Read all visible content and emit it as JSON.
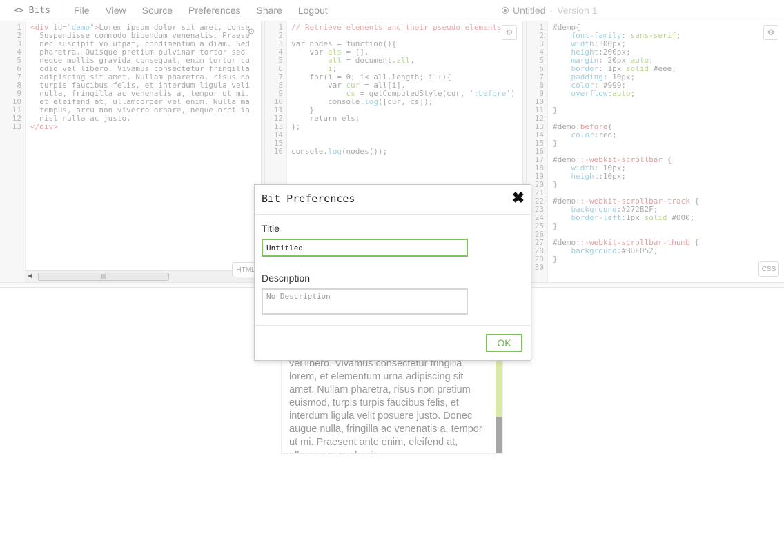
{
  "app": {
    "name": "Bits",
    "logo_icon": "<>"
  },
  "menu": [
    {
      "label": "File"
    },
    {
      "label": "View"
    },
    {
      "label": "Source"
    },
    {
      "label": "Preferences"
    },
    {
      "label": "Share"
    },
    {
      "label": "Logout"
    }
  ],
  "bit": {
    "title": "Untitled",
    "separator": "·",
    "version": "Version 1"
  },
  "editors": {
    "html": {
      "mode": "HTML",
      "lines": [
        "1",
        "2",
        "3",
        "4",
        "5",
        "6",
        "7",
        "8",
        "9",
        "10",
        "11",
        "12",
        "13"
      ],
      "code": [
        [
          {
            "c": "tok-tag",
            "t": "<div "
          },
          {
            "c": "tok-attr",
            "t": "id="
          },
          {
            "c": "tok-str",
            "t": "\"demo\""
          },
          {
            "c": "tok-tag",
            "t": ">"
          },
          {
            "c": "",
            "t": "Lorem ipsum dolor sit amet, conse"
          }
        ],
        [
          {
            "c": "",
            "t": "  Suspendisse commodo bibendum venenatis. Praese"
          }
        ],
        [
          {
            "c": "",
            "t": "  nec suscipit volutpat, condimentum a diam. Sed"
          }
        ],
        [
          {
            "c": "",
            "t": "  pharetra. Quisque pretium pulvinar tortor sed"
          }
        ],
        [
          {
            "c": "",
            "t": "  neque mollis gravida consequat, enim tortor cu"
          }
        ],
        [
          {
            "c": "",
            "t": "  odio vel libero. Vivamus consectetur fringilla"
          }
        ],
        [
          {
            "c": "",
            "t": "  adipiscing sit amet. Nullam pharetra, risus no"
          }
        ],
        [
          {
            "c": "",
            "t": "  turpis faucibus felis, et interdum ligula veli"
          }
        ],
        [
          {
            "c": "",
            "t": "  nulla, fringilla ac venenatis a, tempor ut mi."
          }
        ],
        [
          {
            "c": "",
            "t": "  et eleifend at, ullamcorper vel enim. Nulla ma"
          }
        ],
        [
          {
            "c": "",
            "t": "  tempus, arcu non viverra ornare, neque orci ia"
          }
        ],
        [
          {
            "c": "",
            "t": "  nisl nulla ac justo."
          }
        ],
        [
          {
            "c": "tok-tag",
            "t": "</div>"
          }
        ]
      ]
    },
    "js": {
      "lines": [
        "1",
        "2",
        "3",
        "4",
        "5",
        "6",
        "7",
        "8",
        "9",
        "10",
        "11",
        "12",
        "13",
        "14",
        "15",
        "16"
      ],
      "code": [
        [
          {
            "c": "tok-com",
            "t": "// Retrieve elements and their pseudo elements"
          }
        ],
        [
          {
            "c": "",
            "t": ""
          }
        ],
        [
          {
            "c": "",
            "t": "var nodes = function(){"
          }
        ],
        [
          {
            "c": "",
            "t": "    var "
          },
          {
            "c": "tok-var",
            "t": "els"
          },
          {
            "c": "",
            "t": " = [],"
          }
        ],
        [
          {
            "c": "",
            "t": "        "
          },
          {
            "c": "tok-var",
            "t": "all"
          },
          {
            "c": "",
            "t": " = document."
          },
          {
            "c": "tok-var",
            "t": "all"
          },
          {
            "c": "",
            "t": ","
          }
        ],
        [
          {
            "c": "",
            "t": "        "
          },
          {
            "c": "tok-var",
            "t": "i"
          },
          {
            "c": "",
            "t": ";"
          }
        ],
        [
          {
            "c": "",
            "t": "    for(i = 0; i< all.length; i++){"
          }
        ],
        [
          {
            "c": "",
            "t": "        var "
          },
          {
            "c": "tok-var",
            "t": "cur"
          },
          {
            "c": "",
            "t": " = all[i],"
          }
        ],
        [
          {
            "c": "",
            "t": "            "
          },
          {
            "c": "tok-var",
            "t": "cs"
          },
          {
            "c": "",
            "t": " = getComputedStyle(cur, "
          },
          {
            "c": "tok-str",
            "t": "':before'"
          },
          {
            "c": "",
            "t": ")"
          }
        ],
        [
          {
            "c": "",
            "t": "        console."
          },
          {
            "c": "tok-prop",
            "t": "log"
          },
          {
            "c": "",
            "t": "([cur, cs]);"
          }
        ],
        [
          {
            "c": "",
            "t": "    }"
          }
        ],
        [
          {
            "c": "",
            "t": "    return els;"
          }
        ],
        [
          {
            "c": "",
            "t": "};"
          }
        ],
        [
          {
            "c": "",
            "t": ""
          }
        ],
        [
          {
            "c": "",
            "t": ""
          }
        ],
        [
          {
            "c": "",
            "t": "console."
          },
          {
            "c": "tok-prop",
            "t": "log"
          },
          {
            "c": "",
            "t": "(nodes());"
          }
        ]
      ]
    },
    "css": {
      "mode": "CSS",
      "lines": [
        "1",
        "2",
        "3",
        "4",
        "5",
        "6",
        "7",
        "8",
        "9",
        "10",
        "11",
        "12",
        "13",
        "14",
        "15",
        "16",
        "17",
        "18",
        "19",
        "20",
        "21",
        "22",
        "23",
        "24",
        "25",
        "26",
        "27",
        "28",
        "29",
        "30"
      ],
      "code": [
        [
          {
            "c": "tok-sel",
            "t": "#demo{"
          }
        ],
        [
          {
            "c": "",
            "t": "    "
          },
          {
            "c": "tok-prop",
            "t": "font-family"
          },
          {
            "c": "",
            "t": ": "
          },
          {
            "c": "tok-var",
            "t": "sans-serif"
          },
          {
            "c": "",
            "t": ";"
          }
        ],
        [
          {
            "c": "",
            "t": "    "
          },
          {
            "c": "tok-prop",
            "t": "width"
          },
          {
            "c": "",
            "t": ":300px;"
          }
        ],
        [
          {
            "c": "",
            "t": "    "
          },
          {
            "c": "tok-prop",
            "t": "height"
          },
          {
            "c": "",
            "t": ":200px;"
          }
        ],
        [
          {
            "c": "",
            "t": "    "
          },
          {
            "c": "tok-prop",
            "t": "margin"
          },
          {
            "c": "",
            "t": ": 20px "
          },
          {
            "c": "tok-var",
            "t": "auto"
          },
          {
            "c": "",
            "t": ";"
          }
        ],
        [
          {
            "c": "",
            "t": "    "
          },
          {
            "c": "tok-prop",
            "t": "border"
          },
          {
            "c": "",
            "t": ": 1px "
          },
          {
            "c": "tok-var",
            "t": "solid"
          },
          {
            "c": "",
            "t": " #eee;"
          }
        ],
        [
          {
            "c": "",
            "t": "    "
          },
          {
            "c": "tok-prop",
            "t": "padding"
          },
          {
            "c": "",
            "t": ": 10px;"
          }
        ],
        [
          {
            "c": "",
            "t": "    "
          },
          {
            "c": "tok-prop",
            "t": "color"
          },
          {
            "c": "",
            "t": ": #999;"
          }
        ],
        [
          {
            "c": "",
            "t": "    "
          },
          {
            "c": "tok-prop",
            "t": "overflow"
          },
          {
            "c": "",
            "t": ":"
          },
          {
            "c": "tok-var",
            "t": "auto"
          },
          {
            "c": "",
            "t": ";"
          }
        ],
        [
          {
            "c": "",
            "t": ""
          }
        ],
        [
          {
            "c": "tok-sel",
            "t": "}"
          }
        ],
        [
          {
            "c": "",
            "t": ""
          }
        ],
        [
          {
            "c": "tok-sel",
            "t": "#demo"
          },
          {
            "c": "tok-pse",
            "t": ":before"
          },
          {
            "c": "tok-sel",
            "t": "{"
          }
        ],
        [
          {
            "c": "",
            "t": "    "
          },
          {
            "c": "tok-prop",
            "t": "color"
          },
          {
            "c": "",
            "t": ":red;"
          }
        ],
        [
          {
            "c": "tok-sel",
            "t": "}"
          }
        ],
        [
          {
            "c": "",
            "t": ""
          }
        ],
        [
          {
            "c": "tok-sel",
            "t": "#demo"
          },
          {
            "c": "tok-pse",
            "t": "::-webkit-scrollbar"
          },
          {
            "c": "tok-sel",
            "t": " {"
          }
        ],
        [
          {
            "c": "",
            "t": "    "
          },
          {
            "c": "tok-prop",
            "t": "width"
          },
          {
            "c": "",
            "t": ": 10px;"
          }
        ],
        [
          {
            "c": "",
            "t": "    "
          },
          {
            "c": "tok-prop",
            "t": "height"
          },
          {
            "c": "",
            "t": ":10px;"
          }
        ],
        [
          {
            "c": "tok-sel",
            "t": "}"
          }
        ],
        [
          {
            "c": "",
            "t": ""
          }
        ],
        [
          {
            "c": "tok-sel",
            "t": "#demo"
          },
          {
            "c": "tok-pse",
            "t": "::-webkit-scrollbar-track"
          },
          {
            "c": "tok-sel",
            "t": " {"
          }
        ],
        [
          {
            "c": "",
            "t": "    "
          },
          {
            "c": "tok-prop",
            "t": "background"
          },
          {
            "c": "",
            "t": ":#272B2F;"
          }
        ],
        [
          {
            "c": "",
            "t": "    "
          },
          {
            "c": "tok-prop",
            "t": "border-left"
          },
          {
            "c": "",
            "t": ":1px "
          },
          {
            "c": "tok-var",
            "t": "solid"
          },
          {
            "c": "",
            "t": " #000;"
          }
        ],
        [
          {
            "c": "tok-sel",
            "t": "}"
          }
        ],
        [
          {
            "c": "",
            "t": ""
          }
        ],
        [
          {
            "c": "tok-sel",
            "t": "#demo"
          },
          {
            "c": "tok-pse",
            "t": "::-webkit-scrollbar-thumb"
          },
          {
            "c": "tok-sel",
            "t": " {"
          }
        ],
        [
          {
            "c": "",
            "t": "    "
          },
          {
            "c": "tok-prop",
            "t": "background"
          },
          {
            "c": "",
            "t": ":#BDE052;"
          }
        ],
        [
          {
            "c": "tok-sel",
            "t": "}"
          }
        ],
        [
          {
            "c": "",
            "t": ""
          }
        ]
      ]
    }
  },
  "preview": {
    "text": "vel libero. Vivamus consectetur fringilla lorem, et elementum urna adipiscing sit amet. Nullam pharetra, risus non pretium euismod, turpis turpis faucibus felis, et interdum ligula velit posuere justo. Donec augue nulla, fringilla ac venenatis a, tempor ut mi. Praesent ante enim, eleifend at, ullamcorper vel enim."
  },
  "modal": {
    "title": "Bit Preferences",
    "close_glyph": "✖",
    "title_label": "Title",
    "title_value": "Untitled",
    "description_label": "Description",
    "description_placeholder": "No Description",
    "ok_label": "OK"
  },
  "colors": {
    "accent_green": "#7dc35a",
    "scroll_track": "#272b2f",
    "scroll_thumb": "#bde052"
  }
}
